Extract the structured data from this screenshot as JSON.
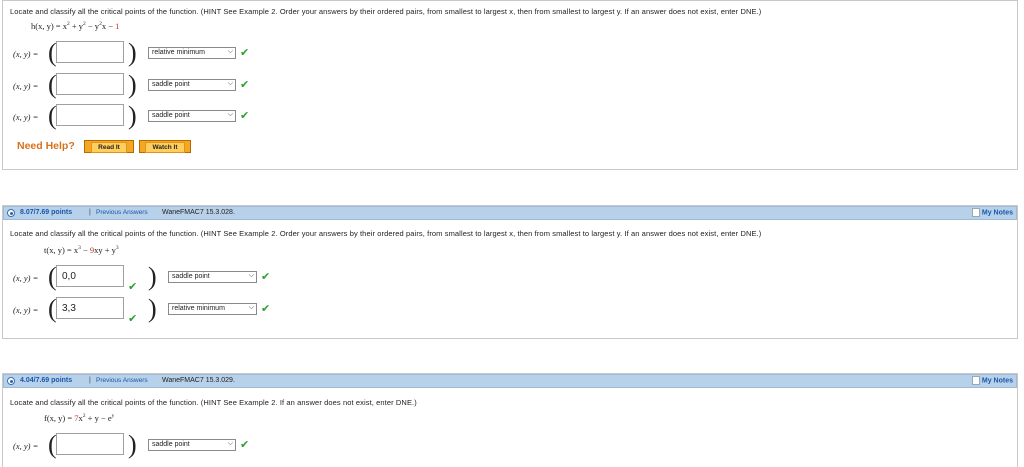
{
  "q1": {
    "text": "Locate and classify all the critical points of the function. (HINT See Example 2. Order your answers by their ordered pairs, from smallest to largest x, then from smallest to largest y. If an answer does not exist, enter DNE.)",
    "func_prefix": "h(x, y) = x",
    "func_mid1": " + y",
    "func_mid2": " − y",
    "func_mid3": "x − ",
    "func_const": "1",
    "exp2": "2",
    "rows": [
      {
        "label": "(x, y) =",
        "value": "",
        "select": "relative minimum"
      },
      {
        "label": "(x, y) =",
        "value": "",
        "select": "saddle point"
      },
      {
        "label": "(x, y) =",
        "value": "",
        "select": "saddle point"
      }
    ],
    "need_help": "Need Help?",
    "read_it": "Read It",
    "watch_it": "Watch It"
  },
  "q2": {
    "points": "8.07/7.69 points",
    "separator": "|",
    "previous_answers": "Previous Answers",
    "code": "WaneFMAC7 15.3.028.",
    "my_notes": "My Notes",
    "text": "Locate and classify all the critical points of the function. (HINT See Example 2. Order your answers by their ordered pairs, from smallest to largest x, then from smallest to largest y. If an answer does not exist, enter DNE.)",
    "func_a": "t(x, y) = x",
    "exp3": "3",
    "func_b": " − ",
    "func_red": "9",
    "func_c": "xy + y",
    "rows": [
      {
        "label": "(x, y) =",
        "value": "0,0",
        "select": "saddle point"
      },
      {
        "label": "(x, y) =",
        "value": "3,3",
        "select": "relative minimum"
      }
    ]
  },
  "q3": {
    "points": "4.04/7.69 points",
    "separator": "|",
    "previous_answers": "Previous Answers",
    "code": "WaneFMAC7 15.3.029.",
    "my_notes": "My Notes",
    "text": "Locate and classify all the critical points of the function. (HINT See Example 2. If an answer does not exist, enter DNE.)",
    "func_a": "f(x, y) = ",
    "func_red": "7",
    "func_b": "x",
    "exp2": "2",
    "func_c": " + y − e",
    "exp_y": "y",
    "rows": [
      {
        "label": "(x, y) =",
        "value": "",
        "select": "saddle point"
      }
    ]
  }
}
